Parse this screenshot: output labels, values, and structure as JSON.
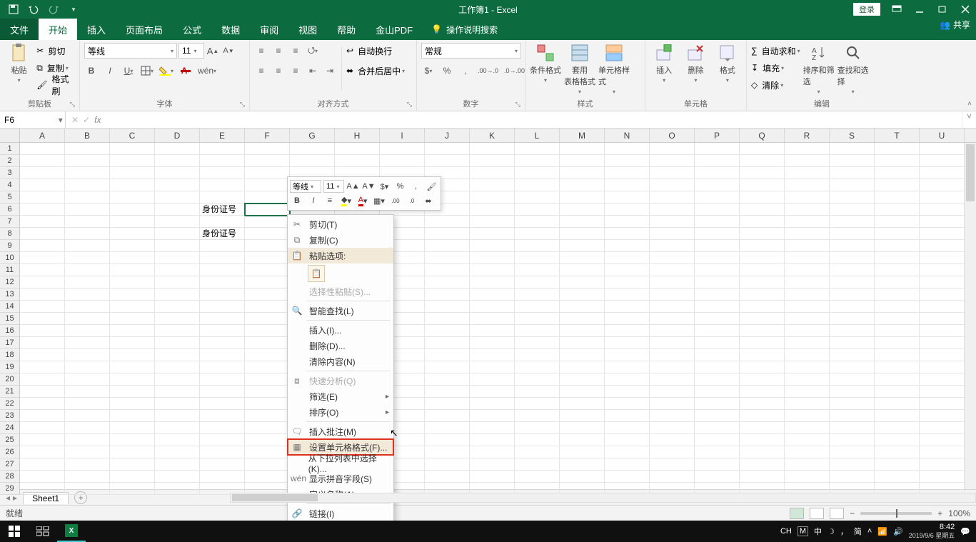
{
  "title_bar": {
    "document_title": "工作簿1 - Excel",
    "login_label": "登录"
  },
  "tabs": {
    "file": "文件",
    "home": "开始",
    "insert": "插入",
    "page_layout": "页面布局",
    "formulas": "公式",
    "data": "数据",
    "review": "审阅",
    "view": "视图",
    "help": "帮助",
    "jspdf": "金山PDF",
    "tell_me": "操作说明搜索",
    "share": "共享"
  },
  "ribbon": {
    "clipboard": {
      "label": "剪贴板",
      "paste": "粘贴",
      "cut": "剪切",
      "copy": "复制",
      "format_painter": "格式刷"
    },
    "font": {
      "label": "字体",
      "name": "等线",
      "size": "11"
    },
    "alignment": {
      "label": "对齐方式",
      "wrap": "自动换行",
      "merge": "合并后居中"
    },
    "number": {
      "label": "数字",
      "format": "常规"
    },
    "styles": {
      "label": "样式",
      "cond": "条件格式",
      "table": "套用\n表格格式",
      "cell": "单元格样式"
    },
    "cells": {
      "label": "单元格",
      "insert": "插入",
      "delete": "删除",
      "format": "格式"
    },
    "editing": {
      "label": "编辑",
      "autosum": "自动求和",
      "fill": "填充",
      "clear": "清除",
      "sort": "排序和筛选",
      "find": "查找和选择"
    }
  },
  "name_box": "F6",
  "formula_bar_value": "",
  "columns": [
    "A",
    "B",
    "C",
    "D",
    "E",
    "F",
    "G",
    "H",
    "I",
    "J",
    "K",
    "L",
    "M",
    "N",
    "O",
    "P",
    "Q",
    "R",
    "S",
    "T",
    "U"
  ],
  "row_count": 29,
  "cells": {
    "E6": "身份证号",
    "E8": "身份证号"
  },
  "selected_cell": "F6",
  "sheet_tabs": {
    "active": "Sheet1"
  },
  "status_bar": {
    "mode": "就绪",
    "zoom": "100%"
  },
  "mini_toolbar": {
    "font": "等线",
    "size": "11"
  },
  "context_menu": {
    "cut": "剪切(T)",
    "copy": "复制(C)",
    "paste_options": "粘贴选项:",
    "paste_special": "选择性粘贴(S)...",
    "smart_lookup": "智能查找(L)",
    "insert": "插入(I)...",
    "delete": "删除(D)...",
    "clear": "清除内容(N)",
    "quick_analysis": "快速分析(Q)",
    "filter": "筛选(E)",
    "sort": "排序(O)",
    "insert_comment": "插入批注(M)",
    "format_cells": "设置单元格格式(F)...",
    "dropdown_pick": "从下拉列表中选择(K)...",
    "show_pinyin": "显示拼音字段(S)",
    "define_name": "定义名称(A)...",
    "hyperlink": "链接(I)"
  },
  "taskbar": {
    "ime1": "CH",
    "ime2": "简",
    "clock_time": "8:42",
    "clock_date": "2019/9/6 星期五"
  }
}
